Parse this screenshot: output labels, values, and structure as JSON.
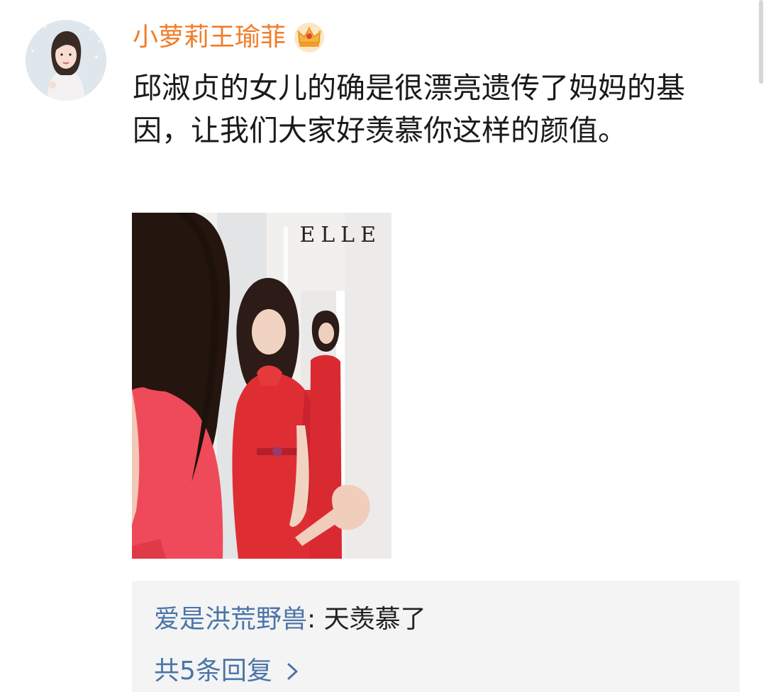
{
  "user": {
    "name": "小萝莉王瑜菲",
    "badge_icon": "crown-icon",
    "name_color": "#f07d2a"
  },
  "comment": {
    "text": "邱淑贞的女儿的确是很漂亮遗传了妈妈的基因，让我们大家好羡慕你这样的颜值。"
  },
  "photo": {
    "logo_text": "ELLE"
  },
  "reply": {
    "author": "爱是洪荒野兽",
    "separator": ": ",
    "text": "天羡慕了",
    "more_label": "共5条回复",
    "link_color": "#4b75a8"
  }
}
